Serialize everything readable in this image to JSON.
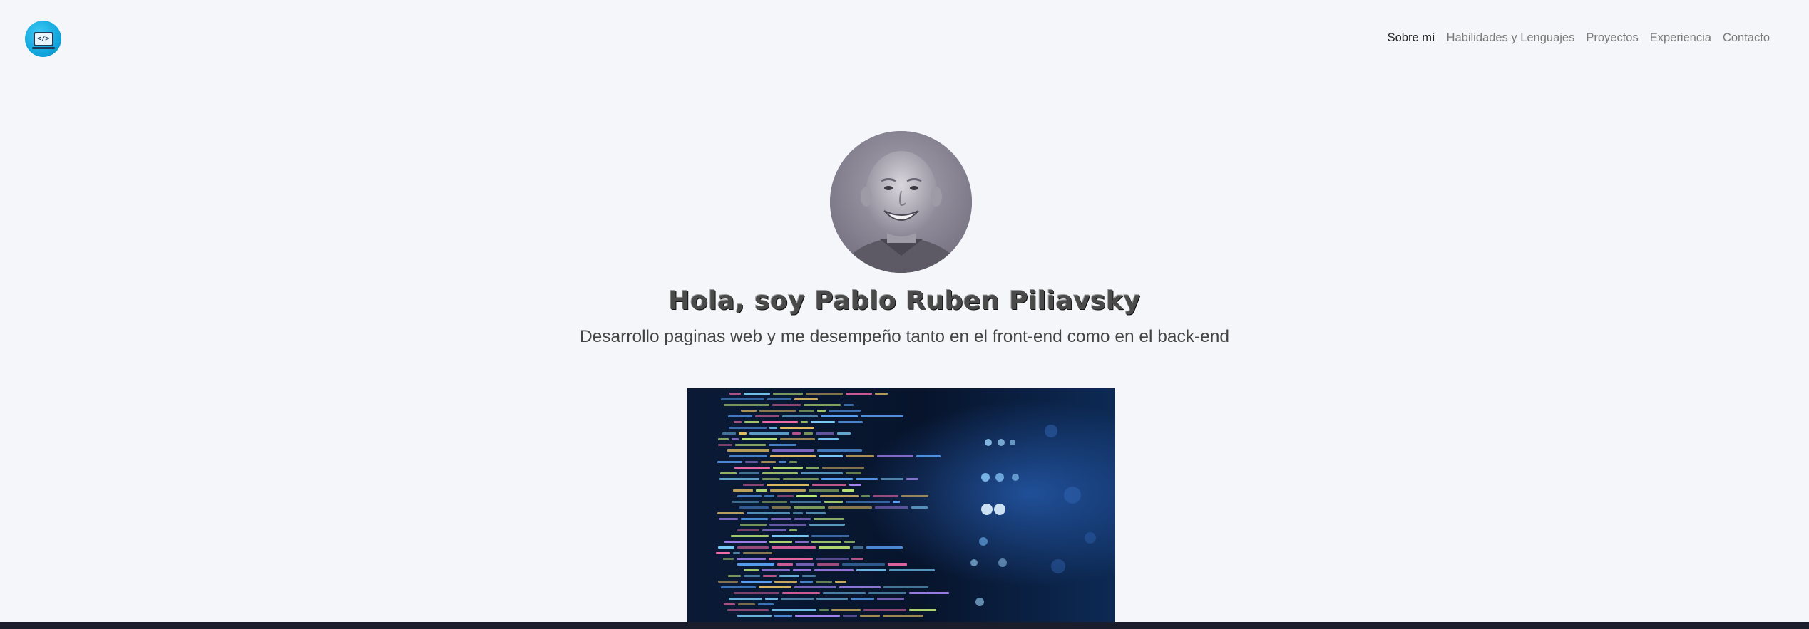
{
  "nav": {
    "logo_icon": "laptop-code-icon",
    "logo_code_text": "</>",
    "links": [
      {
        "label": "Sobre mí",
        "active": true
      },
      {
        "label": "Habilidades y Lenguajes",
        "active": false
      },
      {
        "label": "Proyectos",
        "active": false
      },
      {
        "label": "Experiencia",
        "active": false
      },
      {
        "label": "Contacto",
        "active": false
      }
    ]
  },
  "hero": {
    "title": "Hola, soy Pablo Ruben Piliavsky",
    "subtitle": "Desarrollo paginas web y me desempeño tanto en el front-end como en el back-end"
  },
  "colors": {
    "background": "#f4f6f9",
    "logo_blue": "#12a7de",
    "footer": "#1a1d2c"
  }
}
